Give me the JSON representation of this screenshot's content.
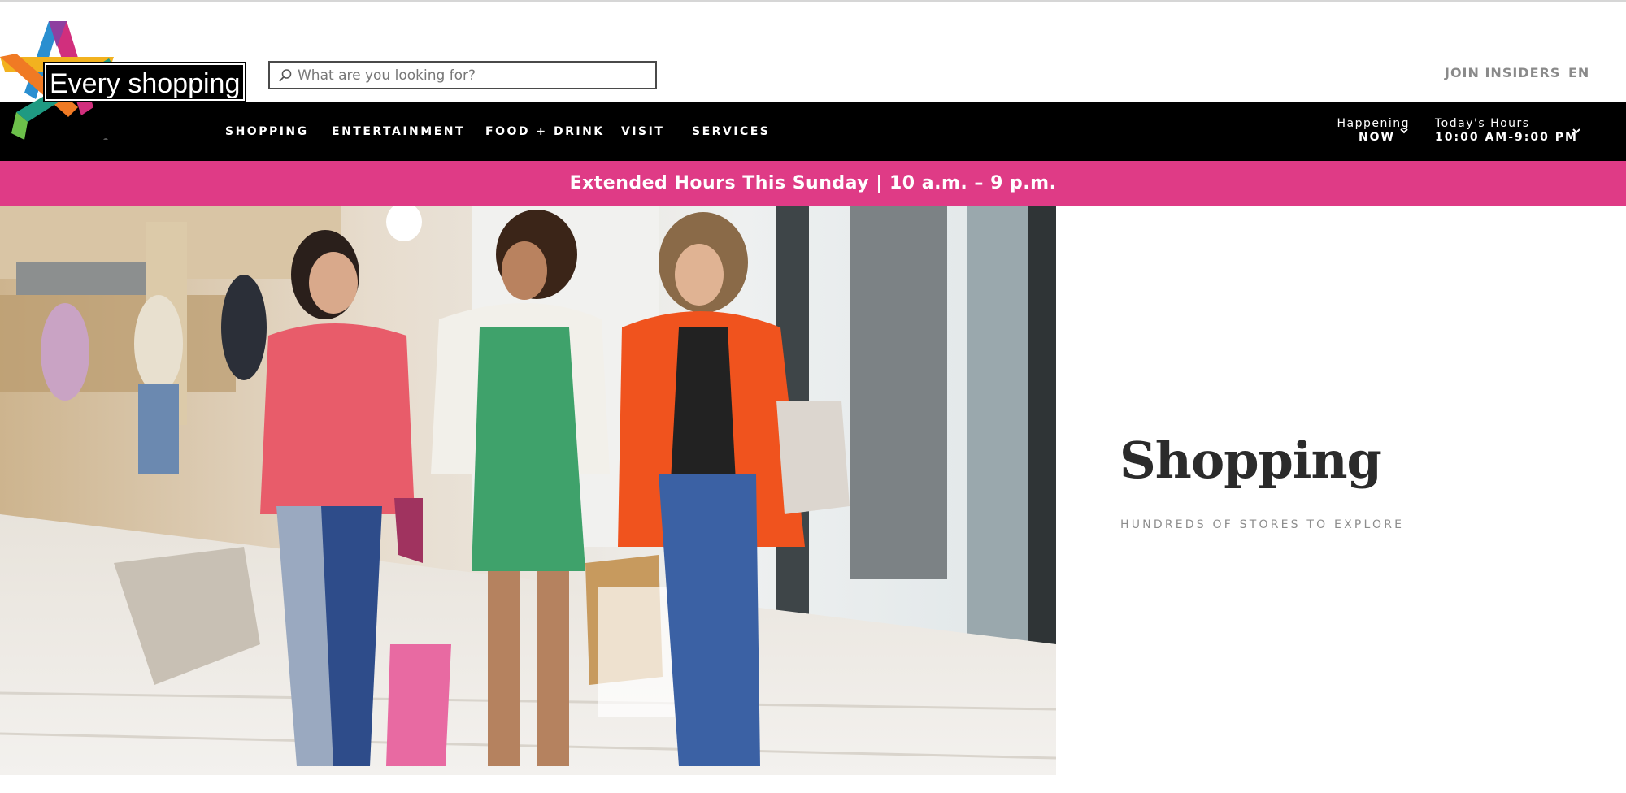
{
  "header": {
    "logo_caption": "Every shopping",
    "search_placeholder": "What are you looking for?",
    "join_label": "JOIN INSIDERS",
    "language_label": "EN"
  },
  "nav": {
    "items": [
      {
        "label": "SHOPPING"
      },
      {
        "label": "ENTERTAINMENT"
      },
      {
        "label": "FOOD + DRINK"
      },
      {
        "label": "VISIT"
      },
      {
        "label": "SERVICES"
      }
    ],
    "happening_line1": "Happening",
    "happening_line2": "NOW",
    "hours_line1": "Today's Hours",
    "hours_line2": "10:00 AM-9:00 PM"
  },
  "banner": {
    "text": "Extended Hours This Sunday | 10 a.m. – 9 p.m.",
    "color": "#df3b86"
  },
  "hero": {
    "title": "Shopping",
    "subtitle": "HUNDREDS OF STORES TO EXPLORE"
  },
  "icons": {
    "search": "search-icon",
    "chevron": "chevron-down-icon",
    "logo": "star-logo"
  }
}
